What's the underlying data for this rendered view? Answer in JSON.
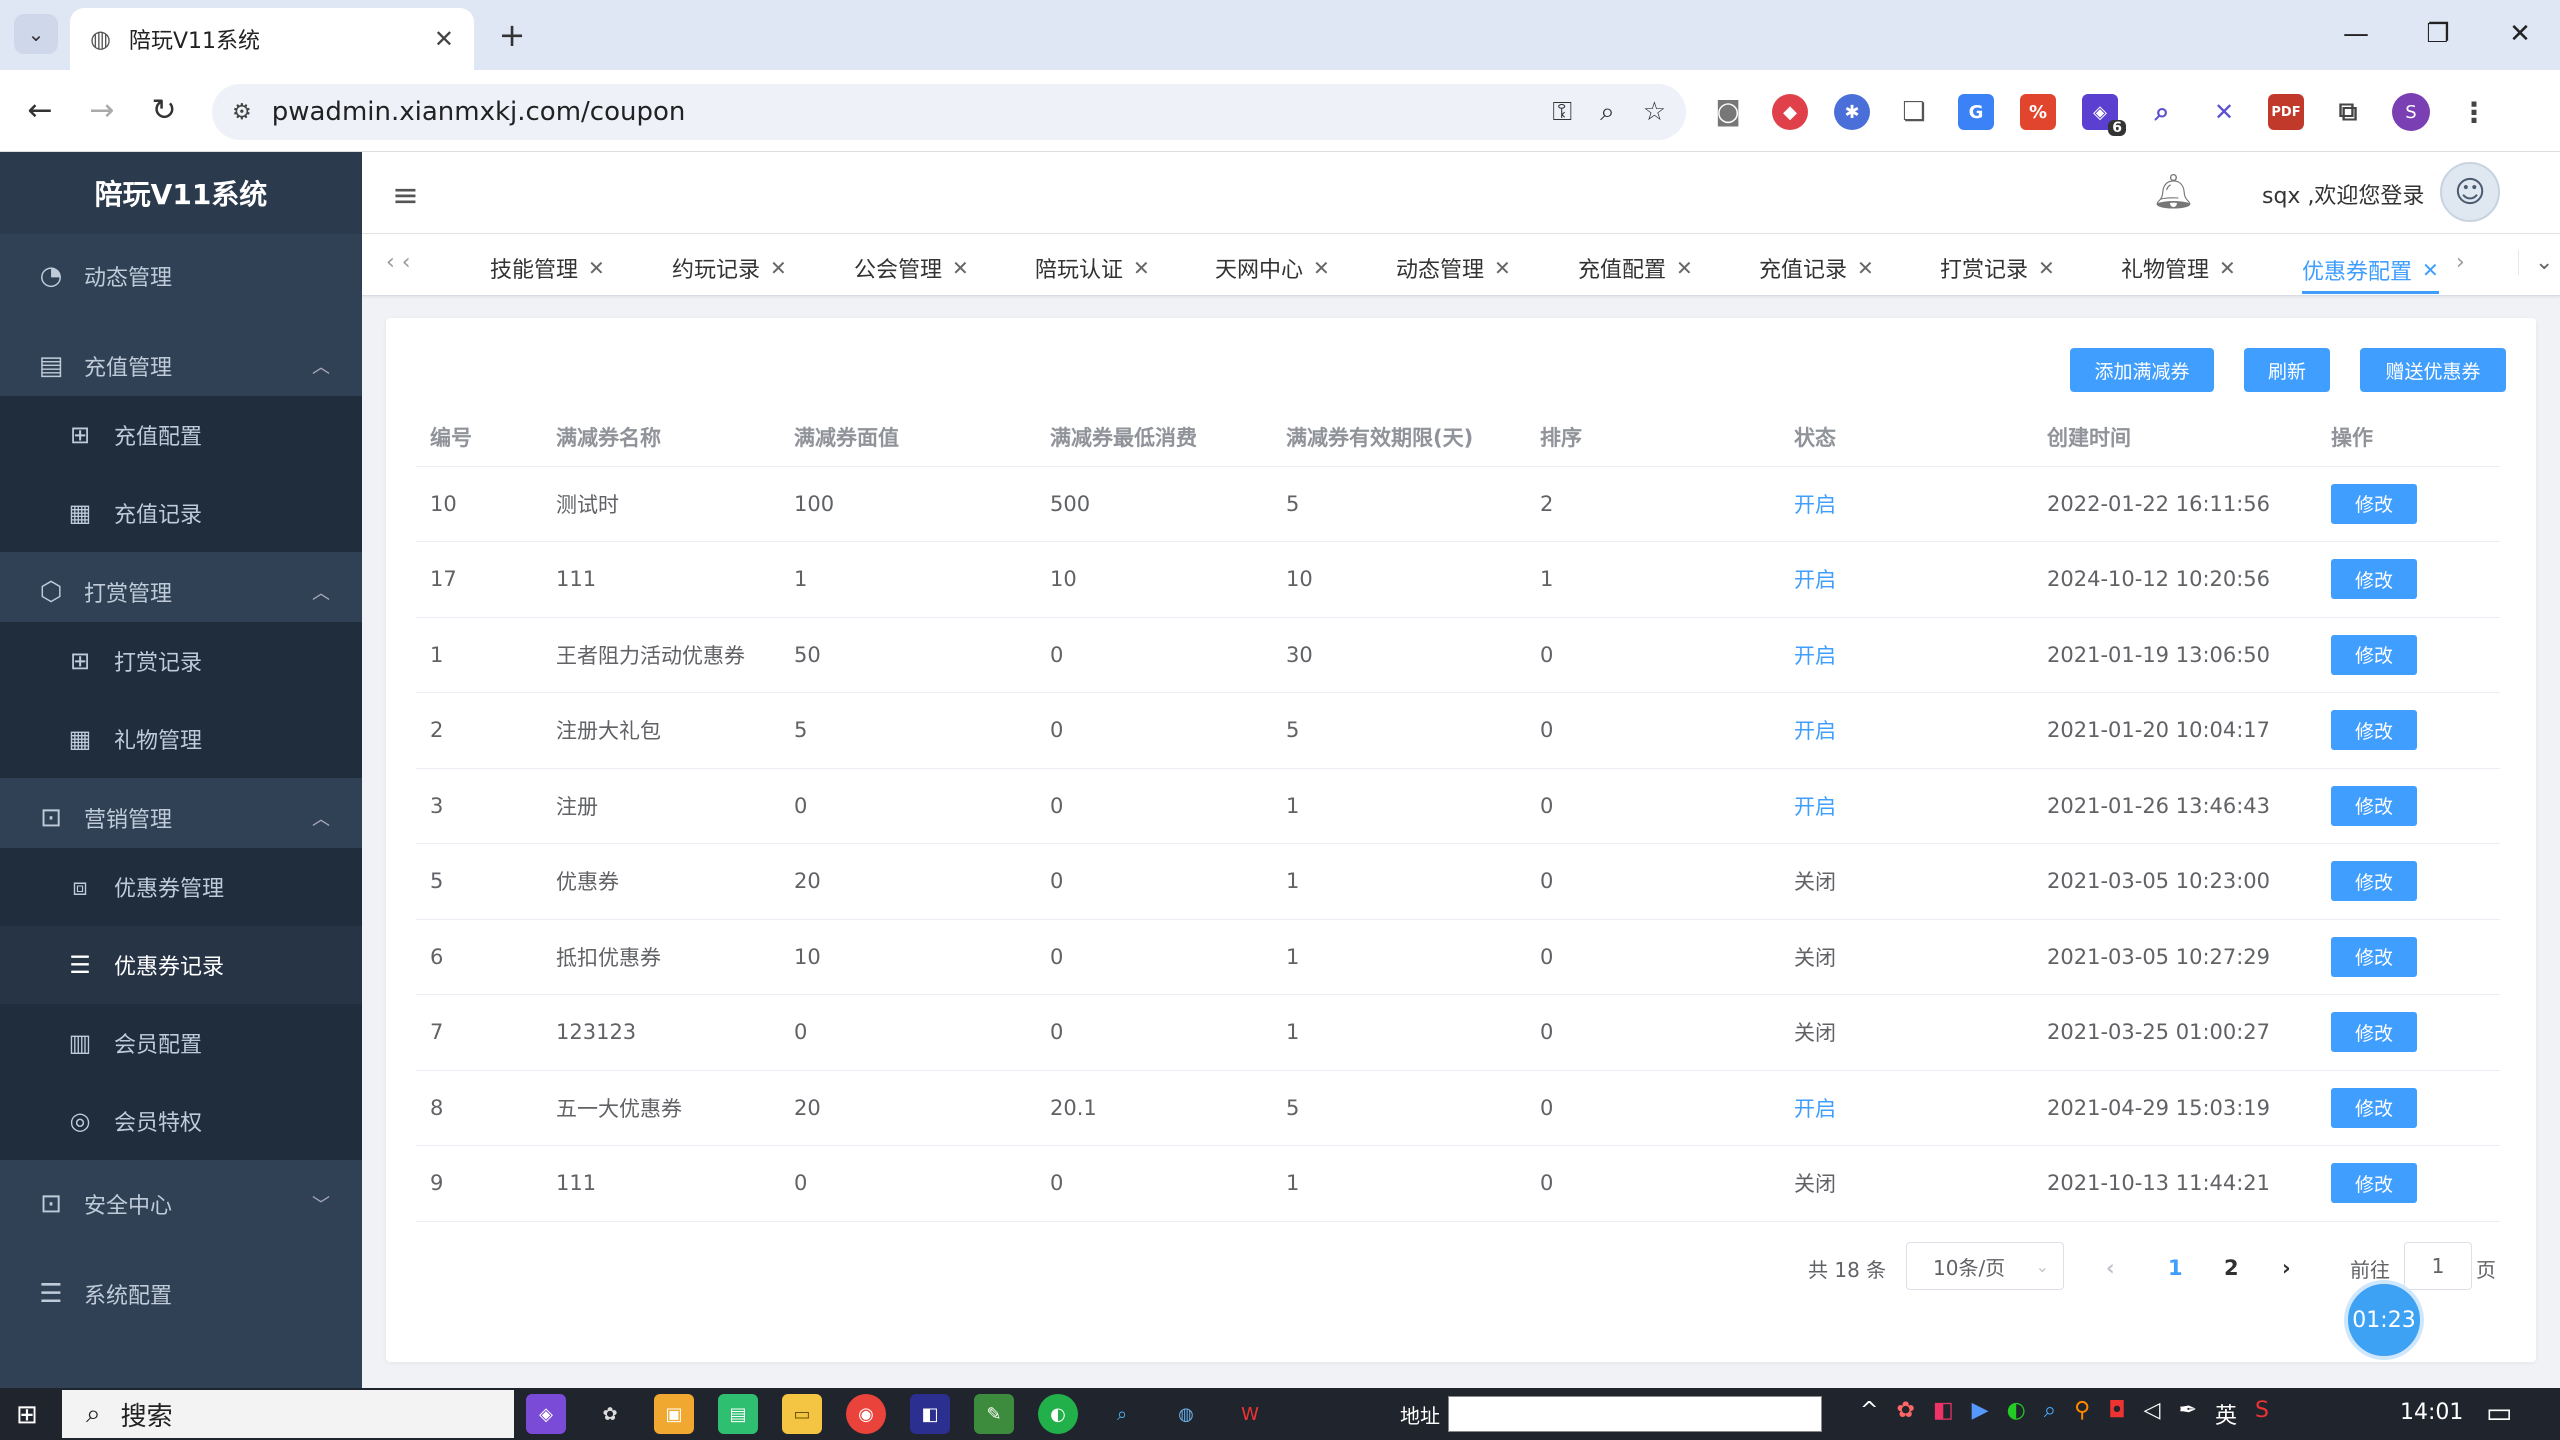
{
  "browser": {
    "tab_title": "陪玩V11系统",
    "url": "pwadmin.xianmxkj.com/coupon",
    "profile_initial": "S",
    "ext_badge": "6",
    "ext_pdf": "PDF"
  },
  "sidebar": {
    "logo": "陪玩V11系统",
    "items": [
      {
        "label": "动态管理"
      },
      {
        "label": "充值管理"
      },
      {
        "label": "充值配置"
      },
      {
        "label": "充值记录"
      },
      {
        "label": "打赏管理"
      },
      {
        "label": "打赏记录"
      },
      {
        "label": "礼物管理"
      },
      {
        "label": "营销管理"
      },
      {
        "label": "优惠券管理"
      },
      {
        "label": "优惠券记录"
      },
      {
        "label": "会员配置"
      },
      {
        "label": "会员特权"
      },
      {
        "label": "安全中心"
      },
      {
        "label": "系统配置"
      }
    ]
  },
  "header": {
    "welcome": "sqx ,欢迎您登录"
  },
  "tags": [
    "技能管理",
    "约玩记录",
    "公会管理",
    "陪玩认证",
    "天网中心",
    "动态管理",
    "充值配置",
    "充值记录",
    "打赏记录",
    "礼物管理",
    "优惠券配置"
  ],
  "toolbar": {
    "add_label": "添加满减券",
    "refresh_label": "刷新",
    "gift_label": "赠送优惠券"
  },
  "table": {
    "columns": [
      "编号",
      "满减券名称",
      "满减券面值",
      "满减券最低消费",
      "满减券有效期限(天)",
      "排序",
      "状态",
      "创建时间",
      "操作"
    ],
    "edit_label": "修改",
    "rows": [
      {
        "id": "10",
        "name": "测试时",
        "value": "100",
        "min": "500",
        "days": "5",
        "sort": "2",
        "status": "开启",
        "created": "2022-01-22 16:11:56"
      },
      {
        "id": "17",
        "name": "111",
        "value": "1",
        "min": "10",
        "days": "10",
        "sort": "1",
        "status": "开启",
        "created": "2024-10-12 10:20:56"
      },
      {
        "id": "1",
        "name": "王者阻力活动优惠券",
        "value": "50",
        "min": "0",
        "days": "30",
        "sort": "0",
        "status": "开启",
        "created": "2021-01-19 13:06:50"
      },
      {
        "id": "2",
        "name": "注册大礼包",
        "value": "5",
        "min": "0",
        "days": "5",
        "sort": "0",
        "status": "开启",
        "created": "2021-01-20 10:04:17"
      },
      {
        "id": "3",
        "name": "注册",
        "value": "0",
        "min": "0",
        "days": "1",
        "sort": "0",
        "status": "开启",
        "created": "2021-01-26 13:46:43"
      },
      {
        "id": "5",
        "name": "优惠券",
        "value": "20",
        "min": "0",
        "days": "1",
        "sort": "0",
        "status": "关闭",
        "created": "2021-03-05 10:23:00"
      },
      {
        "id": "6",
        "name": "抵扣优惠券",
        "value": "10",
        "min": "0",
        "days": "1",
        "sort": "0",
        "status": "关闭",
        "created": "2021-03-05 10:27:29"
      },
      {
        "id": "7",
        "name": "123123",
        "value": "0",
        "min": "0",
        "days": "1",
        "sort": "0",
        "status": "关闭",
        "created": "2021-03-25 01:00:27"
      },
      {
        "id": "8",
        "name": "五一大优惠券",
        "value": "20",
        "min": "20.1",
        "days": "5",
        "sort": "0",
        "status": "开启",
        "created": "2021-04-29 15:03:19"
      },
      {
        "id": "9",
        "name": "111",
        "value": "0",
        "min": "0",
        "days": "1",
        "sort": "0",
        "status": "关闭",
        "created": "2021-10-13 11:44:21"
      }
    ]
  },
  "pagination": {
    "total": "共 18 条",
    "page_size": "10条/页",
    "page1": "1",
    "page2": "2",
    "goto_prefix": "前往",
    "goto_value": "1",
    "goto_suffix": "页"
  },
  "timer": "01:23",
  "taskbar": {
    "search": "搜索",
    "address_label": "地址",
    "ime": "英",
    "clock": "14:01"
  },
  "colors": {
    "primary": "#409eff",
    "sidebar": "#304156"
  }
}
